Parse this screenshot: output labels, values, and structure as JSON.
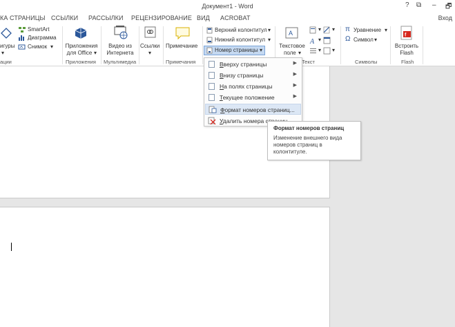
{
  "window": {
    "title": "Документ1 - Word",
    "controls": [
      "?",
      "⧉",
      "–",
      "🗗"
    ],
    "sign_in": "Вход"
  },
  "tabs": [
    "КА СТРАНИЦЫ",
    "ССЫЛКИ",
    "РАССЫЛКИ",
    "РЕЦЕНЗИРОВАНИЕ",
    "ВИД",
    "ACROBAT"
  ],
  "ribbon": {
    "illustrations": {
      "shapes_partial": "игуры",
      "shapes_arrow": "▾",
      "smartart": "SmartArt",
      "chart": "Диаграмма",
      "screenshot": "Снимок",
      "screenshot_arrow": "▾",
      "group_label": "ации"
    },
    "apps": {
      "office_apps_line1": "Приложения",
      "office_apps_line2": "для Office",
      "office_apps_arrow": "▾",
      "group_label": "Приложения"
    },
    "media": {
      "online_video_line1": "Видео из",
      "online_video_line2": "Интернета",
      "group_label": "Мультимедиа"
    },
    "links": {
      "links_label": "Ссылки",
      "links_arrow": "▾",
      "group_label": ""
    },
    "comments": {
      "comment_label": "Примечание",
      "group_label": "Примечания"
    },
    "header_footer": {
      "header": "Верхний колонтитул",
      "footer": "Нижний колонтитул",
      "page_number": "Номер страницы",
      "dropdown_arrow": "▾"
    },
    "text": {
      "textbox_line1": "Текстовое",
      "textbox_line2": "поле",
      "textbox_arrow": "▾",
      "group_label": "Текст",
      "misc_arrow": "▾"
    },
    "symbols": {
      "equation_symbol": "π",
      "equation": "Уравнение",
      "equation_arrow": "▾",
      "symbol_glyph": "Ω",
      "symbol": "Символ",
      "symbol_arrow": "▾",
      "group_label": "Символы"
    },
    "flash": {
      "embed_line1": "Встроить",
      "embed_line2": "Flash",
      "group_label": "Flash"
    }
  },
  "page_number_menu": {
    "items": [
      {
        "first": "В",
        "rest": "верху страницы",
        "submenu": true,
        "arrow": "▶"
      },
      {
        "first": "В",
        "rest": "низу страницы",
        "submenu": true,
        "arrow": "▶"
      },
      {
        "first": "Н",
        "rest": "а полях страницы",
        "submenu": true,
        "arrow": "▶"
      },
      {
        "first": "Т",
        "rest": "екущее положение",
        "submenu": true,
        "arrow": "▶"
      },
      {
        "first": "Ф",
        "rest": "ормат номеров страниц...",
        "submenu": false,
        "highlighted": true
      },
      {
        "first": "У",
        "rest": "далить номера страниц",
        "submenu": false
      }
    ]
  },
  "tooltip": {
    "title": "Формат номеров страниц",
    "body": "Изменение внешнего вида номеров страниц в колонтитуле."
  },
  "colors": {
    "accent": "#2b579a",
    "menu_highlight": "#dce7f5",
    "flash_red": "#d6281e"
  }
}
